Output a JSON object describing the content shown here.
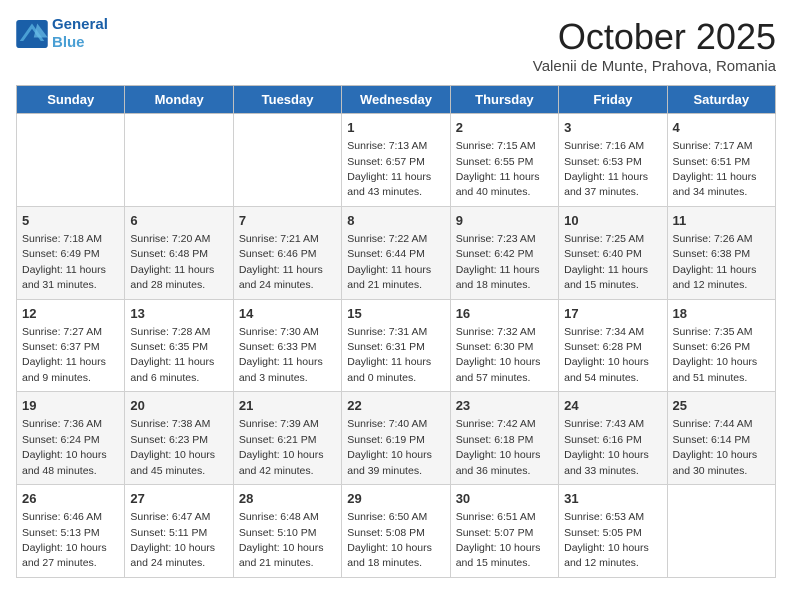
{
  "header": {
    "title": "October 2025",
    "subtitle": "Valenii de Munte, Prahova, Romania",
    "logo_line1": "General",
    "logo_line2": "Blue"
  },
  "weekdays": [
    "Sunday",
    "Monday",
    "Tuesday",
    "Wednesday",
    "Thursday",
    "Friday",
    "Saturday"
  ],
  "weeks": [
    [
      {
        "day": "",
        "info": ""
      },
      {
        "day": "",
        "info": ""
      },
      {
        "day": "",
        "info": ""
      },
      {
        "day": "1",
        "info": "Sunrise: 7:13 AM\nSunset: 6:57 PM\nDaylight: 11 hours and 43 minutes."
      },
      {
        "day": "2",
        "info": "Sunrise: 7:15 AM\nSunset: 6:55 PM\nDaylight: 11 hours and 40 minutes."
      },
      {
        "day": "3",
        "info": "Sunrise: 7:16 AM\nSunset: 6:53 PM\nDaylight: 11 hours and 37 minutes."
      },
      {
        "day": "4",
        "info": "Sunrise: 7:17 AM\nSunset: 6:51 PM\nDaylight: 11 hours and 34 minutes."
      }
    ],
    [
      {
        "day": "5",
        "info": "Sunrise: 7:18 AM\nSunset: 6:49 PM\nDaylight: 11 hours and 31 minutes."
      },
      {
        "day": "6",
        "info": "Sunrise: 7:20 AM\nSunset: 6:48 PM\nDaylight: 11 hours and 28 minutes."
      },
      {
        "day": "7",
        "info": "Sunrise: 7:21 AM\nSunset: 6:46 PM\nDaylight: 11 hours and 24 minutes."
      },
      {
        "day": "8",
        "info": "Sunrise: 7:22 AM\nSunset: 6:44 PM\nDaylight: 11 hours and 21 minutes."
      },
      {
        "day": "9",
        "info": "Sunrise: 7:23 AM\nSunset: 6:42 PM\nDaylight: 11 hours and 18 minutes."
      },
      {
        "day": "10",
        "info": "Sunrise: 7:25 AM\nSunset: 6:40 PM\nDaylight: 11 hours and 15 minutes."
      },
      {
        "day": "11",
        "info": "Sunrise: 7:26 AM\nSunset: 6:38 PM\nDaylight: 11 hours and 12 minutes."
      }
    ],
    [
      {
        "day": "12",
        "info": "Sunrise: 7:27 AM\nSunset: 6:37 PM\nDaylight: 11 hours and 9 minutes."
      },
      {
        "day": "13",
        "info": "Sunrise: 7:28 AM\nSunset: 6:35 PM\nDaylight: 11 hours and 6 minutes."
      },
      {
        "day": "14",
        "info": "Sunrise: 7:30 AM\nSunset: 6:33 PM\nDaylight: 11 hours and 3 minutes."
      },
      {
        "day": "15",
        "info": "Sunrise: 7:31 AM\nSunset: 6:31 PM\nDaylight: 11 hours and 0 minutes."
      },
      {
        "day": "16",
        "info": "Sunrise: 7:32 AM\nSunset: 6:30 PM\nDaylight: 10 hours and 57 minutes."
      },
      {
        "day": "17",
        "info": "Sunrise: 7:34 AM\nSunset: 6:28 PM\nDaylight: 10 hours and 54 minutes."
      },
      {
        "day": "18",
        "info": "Sunrise: 7:35 AM\nSunset: 6:26 PM\nDaylight: 10 hours and 51 minutes."
      }
    ],
    [
      {
        "day": "19",
        "info": "Sunrise: 7:36 AM\nSunset: 6:24 PM\nDaylight: 10 hours and 48 minutes."
      },
      {
        "day": "20",
        "info": "Sunrise: 7:38 AM\nSunset: 6:23 PM\nDaylight: 10 hours and 45 minutes."
      },
      {
        "day": "21",
        "info": "Sunrise: 7:39 AM\nSunset: 6:21 PM\nDaylight: 10 hours and 42 minutes."
      },
      {
        "day": "22",
        "info": "Sunrise: 7:40 AM\nSunset: 6:19 PM\nDaylight: 10 hours and 39 minutes."
      },
      {
        "day": "23",
        "info": "Sunrise: 7:42 AM\nSunset: 6:18 PM\nDaylight: 10 hours and 36 minutes."
      },
      {
        "day": "24",
        "info": "Sunrise: 7:43 AM\nSunset: 6:16 PM\nDaylight: 10 hours and 33 minutes."
      },
      {
        "day": "25",
        "info": "Sunrise: 7:44 AM\nSunset: 6:14 PM\nDaylight: 10 hours and 30 minutes."
      }
    ],
    [
      {
        "day": "26",
        "info": "Sunrise: 6:46 AM\nSunset: 5:13 PM\nDaylight: 10 hours and 27 minutes."
      },
      {
        "day": "27",
        "info": "Sunrise: 6:47 AM\nSunset: 5:11 PM\nDaylight: 10 hours and 24 minutes."
      },
      {
        "day": "28",
        "info": "Sunrise: 6:48 AM\nSunset: 5:10 PM\nDaylight: 10 hours and 21 minutes."
      },
      {
        "day": "29",
        "info": "Sunrise: 6:50 AM\nSunset: 5:08 PM\nDaylight: 10 hours and 18 minutes."
      },
      {
        "day": "30",
        "info": "Sunrise: 6:51 AM\nSunset: 5:07 PM\nDaylight: 10 hours and 15 minutes."
      },
      {
        "day": "31",
        "info": "Sunrise: 6:53 AM\nSunset: 5:05 PM\nDaylight: 10 hours and 12 minutes."
      },
      {
        "day": "",
        "info": ""
      }
    ]
  ]
}
